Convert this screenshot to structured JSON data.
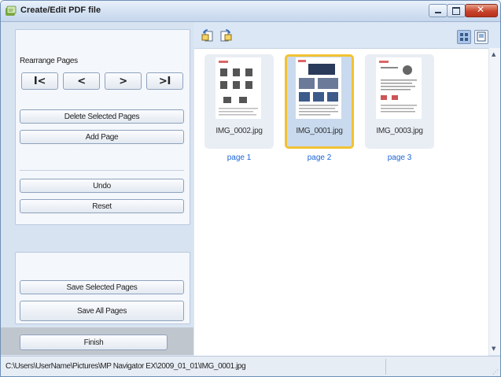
{
  "window": {
    "title": "Create/Edit PDF file"
  },
  "rearrange": {
    "label": "Rearrange Pages",
    "nav": [
      "I<",
      "<",
      ">",
      ">I"
    ],
    "delete_label": "Delete Selected Pages",
    "add_label": "Add Page",
    "undo_label": "Undo",
    "reset_label": "Reset"
  },
  "save": {
    "selected_label": "Save Selected Pages",
    "all_label": "Save All Pages"
  },
  "finish_label": "Finish",
  "pages": [
    {
      "filename": "IMG_0002.jpg",
      "label": "page 1",
      "selected": false
    },
    {
      "filename": "IMG_0001.jpg",
      "label": "page 2",
      "selected": true
    },
    {
      "filename": "IMG_0003.jpg",
      "label": "page 3",
      "selected": false
    }
  ],
  "status": {
    "path": "C:\\Users\\UserName\\Pictures\\MP Navigator EX\\2009_01_01\\IMG_0001.jpg"
  },
  "icons": {
    "app": "pdf-app-icon",
    "rotate_left": "rotate-left-icon",
    "rotate_right": "rotate-right-icon",
    "thumbnail_view": "thumbnail-view-icon",
    "single_view": "single-page-view-icon"
  },
  "colors": {
    "selection": "#f2c233",
    "page_label": "#1c64d8",
    "accent": "#6f8fb5"
  }
}
